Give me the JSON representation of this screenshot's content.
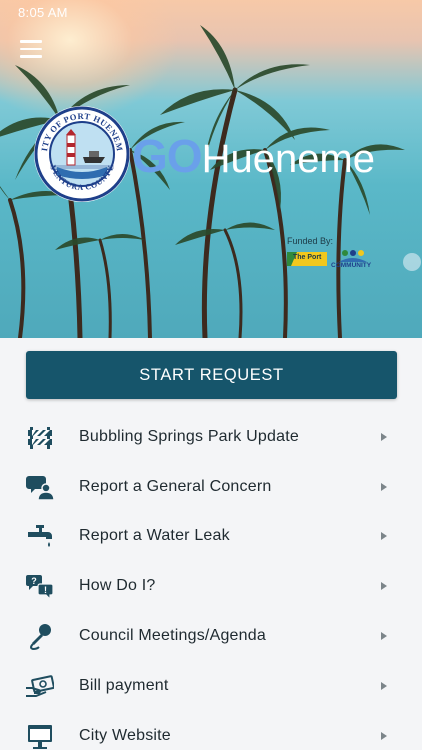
{
  "status_bar": {
    "time": "8:05 AM"
  },
  "header": {
    "brand_go": "GO",
    "brand_name": "Hueneme",
    "seal_top_text": "CITY OF PORT HUENEME",
    "seal_bottom_text": "VENTURA COUNTY",
    "funded_by": "Funded By:",
    "sponsor_port": "The Port",
    "sponsor_community": "COMMUNITY"
  },
  "start_request": {
    "label": "START REQUEST"
  },
  "menu": [
    {
      "label": "Bubbling Springs Park Update",
      "icon": "barricade-icon"
    },
    {
      "label": "Report a General Concern",
      "icon": "user-concern-icon"
    },
    {
      "label": "Report a Water Leak",
      "icon": "faucet-icon"
    },
    {
      "label": "How Do I?",
      "icon": "question-bubble-icon"
    },
    {
      "label": "Council Meetings/Agenda",
      "icon": "microphone-icon"
    },
    {
      "label": "Bill payment",
      "icon": "bill-payment-icon"
    },
    {
      "label": "City Website",
      "icon": "monitor-icon"
    }
  ],
  "colors": {
    "primary": "#16556b",
    "icon": "#1f4d5f",
    "brand_go": "#6aa0ea"
  }
}
